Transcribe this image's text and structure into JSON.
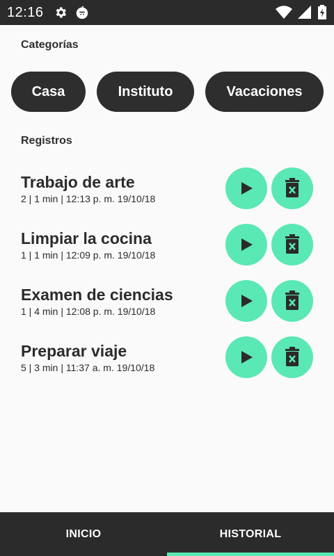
{
  "status_bar": {
    "time": "12:16",
    "icons": [
      "settings-gear-icon",
      "app-notification-icon",
      "wifi-icon",
      "cellular-signal-icon",
      "battery-charging-icon"
    ]
  },
  "categories": {
    "title": "Categorías",
    "items": [
      "Casa",
      "Instituto",
      "Vacaciones"
    ]
  },
  "records": {
    "title": "Registros",
    "items": [
      {
        "title": "Trabajo de arte",
        "meta": "2 | 1 min | 12:13 p. m. 19/10/18"
      },
      {
        "title": "Limpiar la cocina",
        "meta": "1 | 1 min | 12:09 p. m. 19/10/18"
      },
      {
        "title": "Examen de ciencias",
        "meta": "1 | 4 min | 12:08 p. m. 19/10/18"
      },
      {
        "title": "Preparar viaje",
        "meta": "5 | 3 min | 11:37 a. m. 19/10/18"
      }
    ],
    "actions": [
      "play-icon",
      "delete-icon"
    ]
  },
  "bottom_nav": {
    "tabs": [
      "INICIO",
      "HISTORIAL"
    ],
    "active": "HISTORIAL"
  },
  "colors": {
    "dark": "#2b2b2b",
    "accent": "#5ae8b4",
    "background": "#fafafa"
  }
}
